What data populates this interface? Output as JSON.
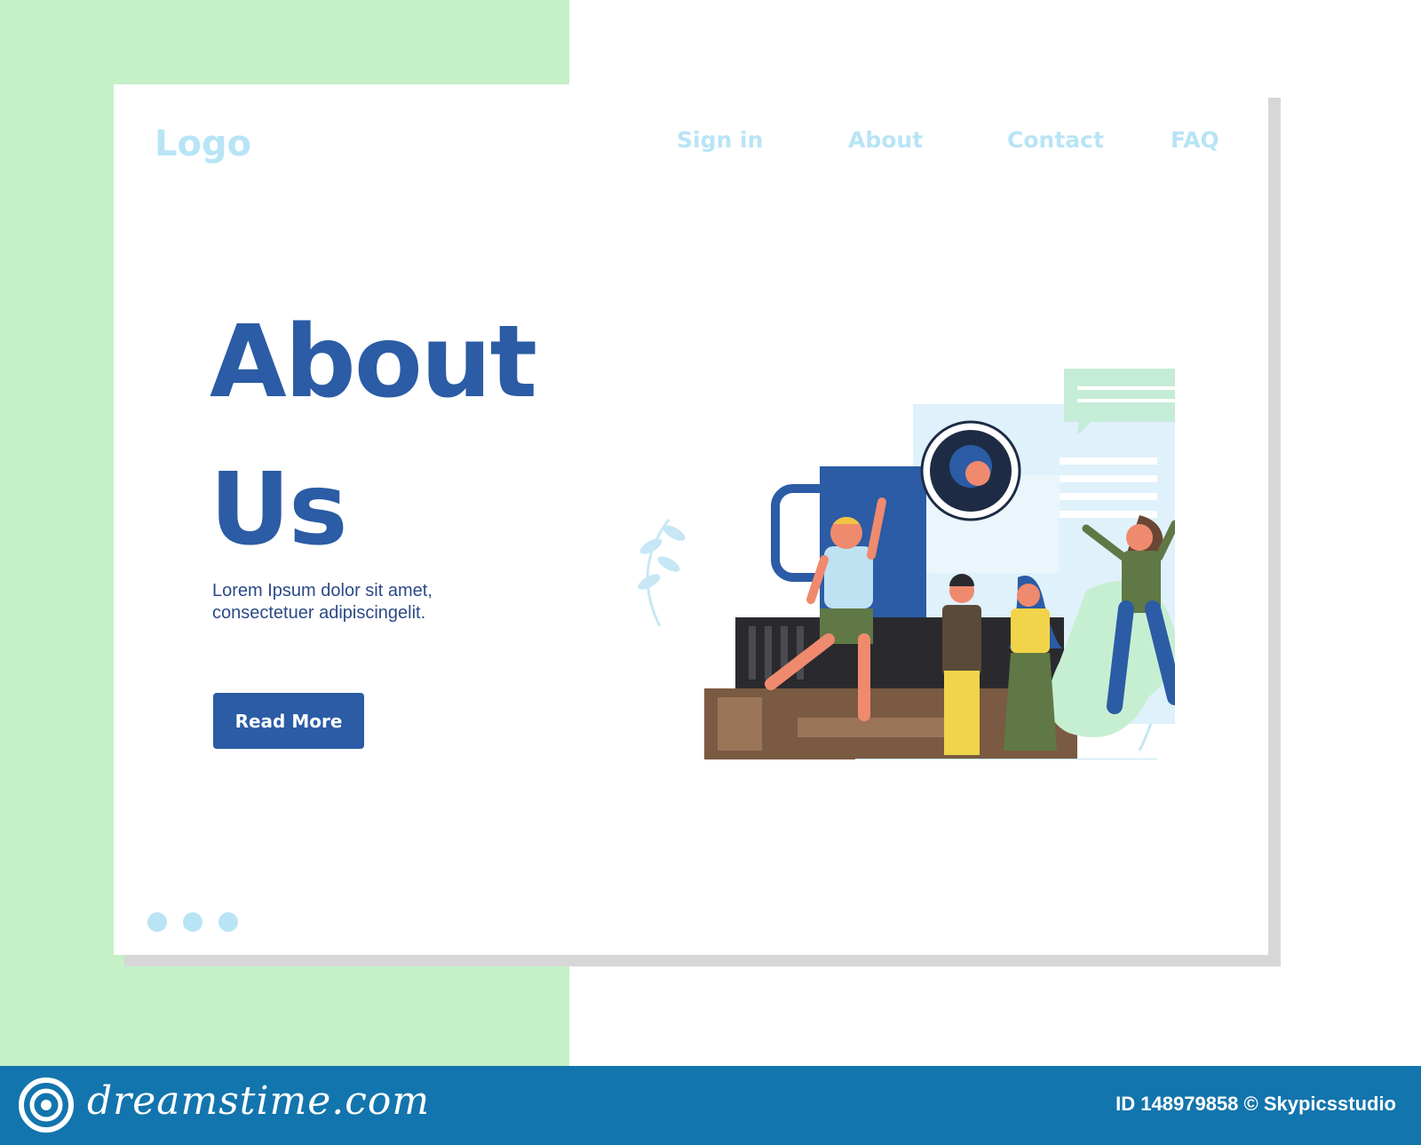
{
  "header": {
    "logo": "Logo",
    "nav": [
      "Sign in",
      "About",
      "Contact",
      "FAQ"
    ]
  },
  "hero": {
    "title_line1": "About",
    "title_line2": "Us",
    "text_line1": "Lorem Ipsum dolor sit amet,",
    "text_line2": "consectetuer adipiscingelit.",
    "button": "Read More"
  },
  "pagination": {
    "dots": 3
  },
  "footer": {
    "brand": "dreamstime.com",
    "image_id": "ID 148979858 © Skypicsstudio"
  },
  "colors": {
    "primary": "#2b5ca5",
    "accent_light": "#b8e4f6",
    "bg_green": "#c5f0c8",
    "footer_blue": "#1375ad"
  }
}
